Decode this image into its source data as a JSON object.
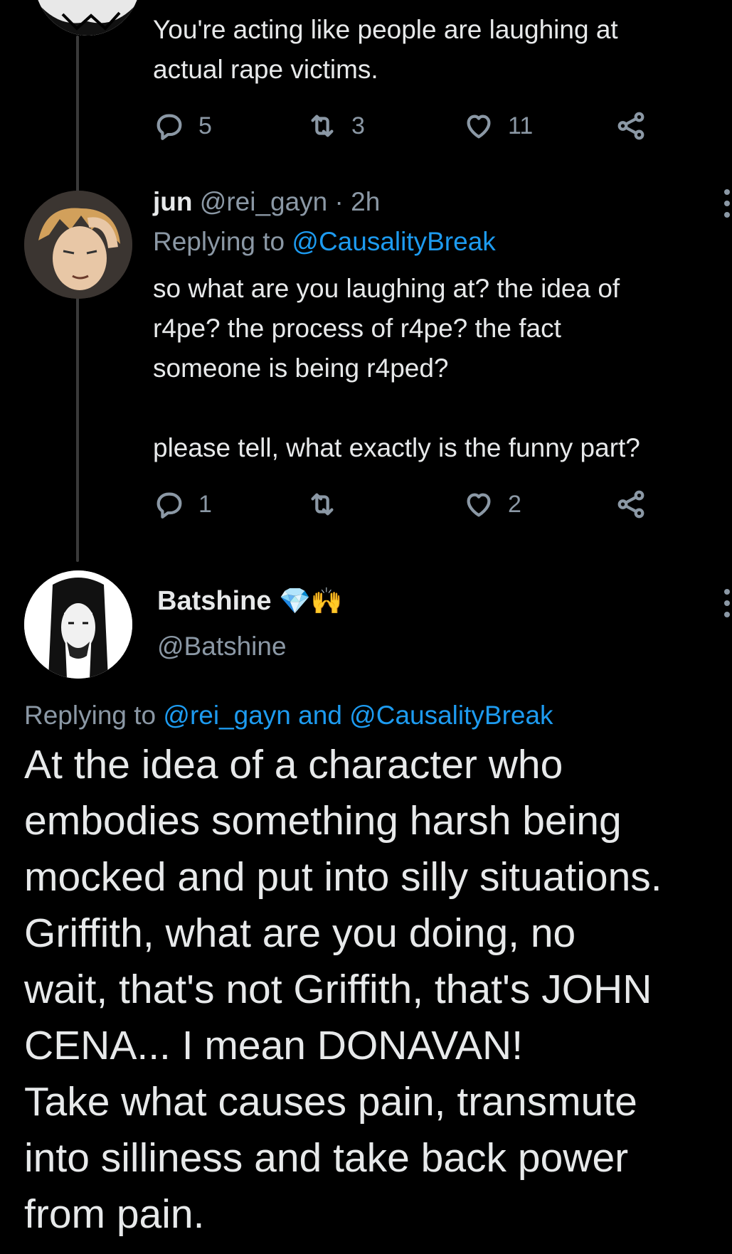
{
  "tweet1": {
    "text": "You're acting like people are laughing at\nactual rape victims.",
    "replies": "5",
    "retweets": "3",
    "likes": "11"
  },
  "tweet2": {
    "name": "jun",
    "handle": "@rei_gayn",
    "separator": "·",
    "time": "2h",
    "replying_prefix": "Replying to",
    "replying_to": "@CausalityBreak",
    "text": "so what are you laughing at? the idea of\nr4pe? the process of r4pe? the fact\nsomeone is being r4ped?\n\nplease tell, what exactly is the funny part?",
    "replies": "1",
    "retweets": "",
    "likes": "2"
  },
  "main_tweet": {
    "name": "Batshine",
    "badge_emoji": "💎🙌",
    "handle": "@Batshine",
    "replying_prefix": "Replying to",
    "replying_to": "@rei_gayn and @CausalityBreak",
    "text": "At the idea of a character who\nembodies something harsh being\nmocked and put into silly situations.\nGriffith, what are you doing, no\nwait, that's not Griffith, that's JOHN\nCENA... I mean DONAVAN!\nTake what causes pain, transmute\ninto silliness and take back power\nfrom pain."
  },
  "colors": {
    "background": "#000000",
    "text": "#e7e9ea",
    "secondary": "#8b98a5",
    "link": "#1d9bf0"
  },
  "icons": [
    "reply-icon",
    "retweet-icon",
    "like-icon",
    "share-icon",
    "more-icon"
  ]
}
